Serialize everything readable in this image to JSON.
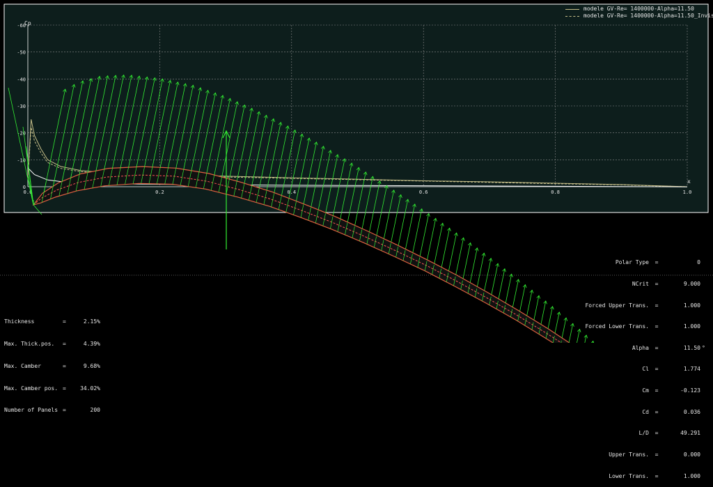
{
  "chart_data": {
    "type": "line",
    "xlabel": "x",
    "ylabel": "Cp",
    "xlim": [
      0,
      1.0
    ],
    "ylim": [
      -60,
      0
    ],
    "y_inverted": true,
    "grid": true,
    "x_ticks": [
      0.0,
      0.2,
      0.4,
      0.6,
      0.8,
      1.0
    ],
    "x_tick_labels": [
      "0.0",
      "0.2",
      "0.4",
      "0.6",
      "0.8",
      "1.0"
    ],
    "y_ticks": [
      0,
      -10,
      -20,
      -30,
      -40,
      -50,
      -60
    ],
    "y_tick_labels": [
      "0",
      "-10",
      "-20",
      "-30",
      "-40",
      "-50",
      "-60"
    ],
    "legend_position": "top-right",
    "series": [
      {
        "name": "modele GV-Re= 1400000-Alpha=11.50",
        "color": "#c8c08a",
        "style": "solid",
        "x": [
          0.0,
          0.005,
          0.01,
          0.02,
          0.03,
          0.05,
          0.08,
          0.12,
          0.2,
          0.3,
          0.4,
          0.5,
          0.6,
          0.7,
          0.8,
          0.9,
          0.95,
          1.0
        ],
        "y": [
          -3,
          -25,
          -19,
          -14,
          -10,
          -7.5,
          -6,
          -5.2,
          -4.5,
          -3.9,
          -3.3,
          -2.8,
          -2.2,
          -1.8,
          -1.3,
          -0.8,
          -0.4,
          0.0
        ]
      },
      {
        "name": "modele GV-Re= 1400000-Alpha=11.50_Inviscid",
        "color": "#c8c08a",
        "style": "dashed",
        "x": [
          0.0,
          0.005,
          0.01,
          0.02,
          0.03,
          0.05,
          0.08,
          0.12,
          0.2,
          0.3,
          0.4,
          0.5,
          0.6,
          0.7,
          0.8,
          0.9,
          0.95,
          1.0
        ],
        "y": [
          -3,
          -22,
          -17,
          -12.5,
          -9,
          -6.8,
          -5.6,
          -4.9,
          -4.2,
          -3.6,
          -3.1,
          -2.6,
          -2.1,
          -1.6,
          -1.1,
          -0.7,
          -0.3,
          0.0
        ]
      },
      {
        "name": "",
        "color": "#ffffff",
        "style": "solid",
        "x": [
          0.0,
          0.01,
          0.03,
          0.06,
          0.1,
          0.2,
          0.3,
          0.4,
          0.5,
          0.6,
          0.7,
          0.8,
          0.9,
          0.95,
          1.0
        ],
        "y": [
          -7,
          -4.5,
          -2.5,
          -1.6,
          -1.2,
          -0.9,
          -0.7,
          -0.55,
          -0.45,
          -0.35,
          -0.25,
          -0.15,
          -0.05,
          0.0,
          0.05
        ]
      }
    ]
  },
  "airfoil": {
    "upper": [
      [
        0.0,
        0.0
      ],
      [
        0.01,
        0.02
      ],
      [
        0.03,
        0.04
      ],
      [
        0.06,
        0.06
      ],
      [
        0.1,
        0.077
      ],
      [
        0.15,
        0.09
      ],
      [
        0.2,
        0.098
      ],
      [
        0.25,
        0.1
      ],
      [
        0.3,
        0.097
      ],
      [
        0.35,
        0.092
      ],
      [
        0.4,
        0.084
      ],
      [
        0.45,
        0.075
      ],
      [
        0.5,
        0.064
      ],
      [
        0.55,
        0.052
      ],
      [
        0.6,
        0.039
      ],
      [
        0.65,
        0.025
      ],
      [
        0.7,
        0.009
      ],
      [
        0.75,
        -0.008
      ],
      [
        0.8,
        -0.026
      ],
      [
        0.85,
        -0.046
      ],
      [
        0.9,
        -0.068
      ],
      [
        0.95,
        -0.091
      ],
      [
        1.0,
        -0.115
      ]
    ],
    "lower": [
      [
        0.0,
        0.0
      ],
      [
        0.01,
        0.005
      ],
      [
        0.03,
        0.018
      ],
      [
        0.06,
        0.034
      ],
      [
        0.1,
        0.05
      ],
      [
        0.15,
        0.064
      ],
      [
        0.2,
        0.073
      ],
      [
        0.25,
        0.076
      ],
      [
        0.3,
        0.074
      ],
      [
        0.35,
        0.07
      ],
      [
        0.4,
        0.063
      ],
      [
        0.45,
        0.055
      ],
      [
        0.5,
        0.045
      ],
      [
        0.55,
        0.034
      ],
      [
        0.6,
        0.022
      ],
      [
        0.65,
        0.008
      ],
      [
        0.7,
        -0.007
      ],
      [
        0.75,
        -0.023
      ],
      [
        0.8,
        -0.041
      ],
      [
        0.85,
        -0.06
      ],
      [
        0.9,
        -0.081
      ],
      [
        0.95,
        -0.102
      ],
      [
        1.0,
        -0.115
      ]
    ],
    "x_scale": [
      0,
      1.0
    ],
    "fill_color": "#111111",
    "outline_color": "#e06040",
    "camber_color": "#ff5555",
    "pressure_vector_color": "#33ee33"
  },
  "legend": [
    {
      "label": "modele GV-Re= 1400000-Alpha=11.50",
      "color": "#c8c08a",
      "style": "solid"
    },
    {
      "label": "modele GV-Re= 1400000-Alpha=11.50_Inviscid",
      "color": "#c8c08a",
      "style": "dashed"
    }
  ],
  "foil_stats": [
    {
      "label": "Thickness",
      "value": "2.15%"
    },
    {
      "label": "Max. Thick.pos.",
      "value": "4.39%"
    },
    {
      "label": "Max. Camber",
      "value": "9.68%"
    },
    {
      "label": "Max. Camber pos.",
      "value": "34.02%"
    },
    {
      "label": "Number of Panels",
      "value": "200"
    }
  ],
  "analysis_params": [
    {
      "label": "Polar Type",
      "value": "0",
      "unit": ""
    },
    {
      "label": "NCrit",
      "value": "9.000",
      "unit": ""
    },
    {
      "label": "Forced Upper Trans.",
      "value": "1.000",
      "unit": ""
    },
    {
      "label": "Forced Lower Trans.",
      "value": "1.000",
      "unit": ""
    },
    {
      "label": "Alpha",
      "value": "11.50",
      "unit": "°"
    },
    {
      "label": "Cl",
      "value": "1.774",
      "unit": ""
    },
    {
      "label": "Cm",
      "value": "-0.123",
      "unit": ""
    },
    {
      "label": "Cd",
      "value": "0.036",
      "unit": ""
    },
    {
      "label": "L/D",
      "value": "49.291",
      "unit": ""
    },
    {
      "label": "Upper Trans.",
      "value": "0.000",
      "unit": ""
    },
    {
      "label": "Lower Trans.",
      "value": "1.000",
      "unit": ""
    }
  ],
  "colors": {
    "background": "#000000",
    "plot_background": "#0d1e1c",
    "frame": "#ffffff",
    "grid": "#8a8a8a",
    "text": "#e8e8e8"
  }
}
